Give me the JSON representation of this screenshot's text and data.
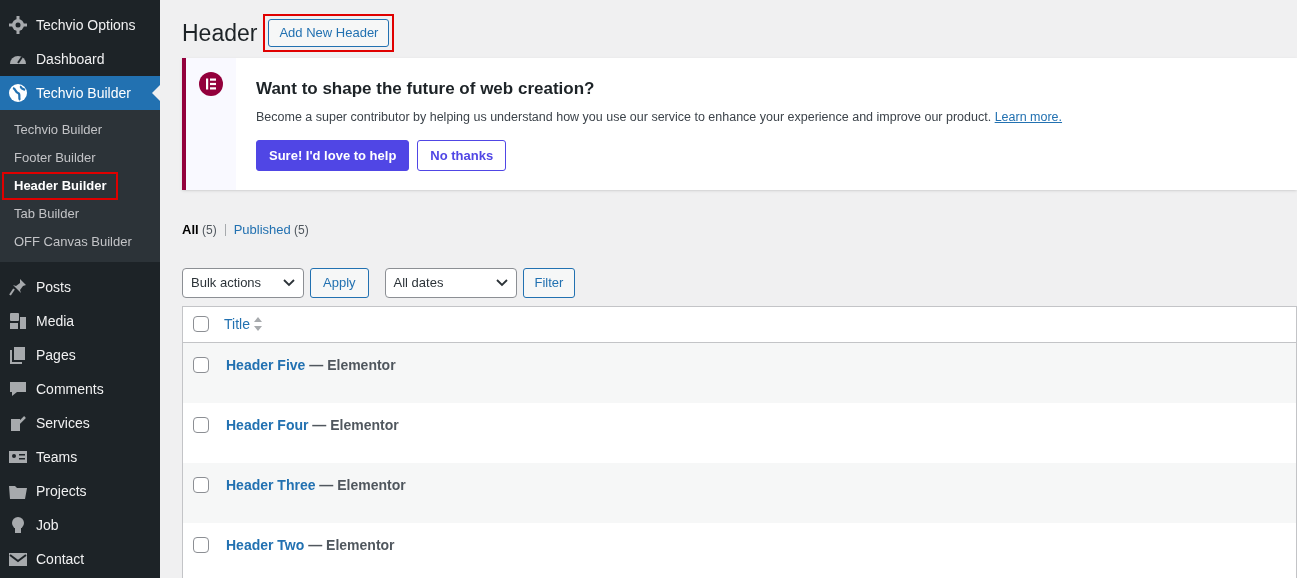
{
  "sidebar": {
    "items": [
      {
        "label": "Techvio Options",
        "selected": false
      },
      {
        "label": "Dashboard",
        "selected": false
      },
      {
        "label": "Techvio Builder",
        "selected": true,
        "children": [
          {
            "label": "Techvio Builder",
            "selected": false,
            "highlighted": false
          },
          {
            "label": "Footer Builder",
            "selected": false,
            "highlighted": false
          },
          {
            "label": "Header Builder",
            "selected": true,
            "highlighted": true
          },
          {
            "label": "Tab Builder",
            "selected": false,
            "highlighted": false
          },
          {
            "label": "OFF Canvas Builder",
            "selected": false,
            "highlighted": false
          }
        ]
      },
      {
        "label": "Posts",
        "selected": false
      },
      {
        "label": "Media",
        "selected": false
      },
      {
        "label": "Pages",
        "selected": false
      },
      {
        "label": "Comments",
        "selected": false
      },
      {
        "label": "Services",
        "selected": false
      },
      {
        "label": "Teams",
        "selected": false
      },
      {
        "label": "Projects",
        "selected": false
      },
      {
        "label": "Job",
        "selected": false
      },
      {
        "label": "Contact",
        "selected": false
      }
    ]
  },
  "page_title": "Header",
  "add_button": {
    "label": "Add New Header",
    "highlighted": true
  },
  "notice": {
    "title": "Want to shape the future of web creation?",
    "text": "Become a super contributor by helping us understand how you use our service to enhance your experience and improve our product.",
    "link": "Learn more.",
    "buttons": [
      {
        "label": "Sure! I'd love to help",
        "kind": "primary"
      },
      {
        "label": "No thanks",
        "kind": "secondary"
      }
    ]
  },
  "filters": [
    {
      "label": "All",
      "count": "(5)",
      "selected": true
    },
    {
      "label": "Published",
      "count": "(5)",
      "selected": false
    }
  ],
  "bulk_select": "Bulk actions",
  "apply_button": "Apply",
  "date_select": "All dates",
  "filter_button": "Filter",
  "table": {
    "columns": [
      "Title"
    ],
    "select_all_checked": false,
    "rows": [
      {
        "title": "Header Five",
        "suffix": "— Elementor",
        "checked": false
      },
      {
        "title": "Header Four",
        "suffix": "— Elementor",
        "checked": false
      },
      {
        "title": "Header Three",
        "suffix": "— Elementor",
        "checked": false
      },
      {
        "title": "Header Two",
        "suffix": "— Elementor",
        "checked": false
      }
    ]
  }
}
